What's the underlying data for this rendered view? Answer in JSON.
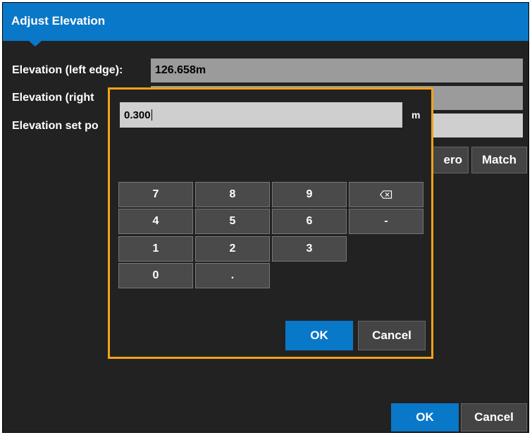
{
  "dialog": {
    "title": "Adjust Elevation",
    "rows": [
      {
        "label": "Elevation (left edge):",
        "value": "126.658m"
      },
      {
        "label": "Elevation (right",
        "value": ""
      },
      {
        "label": "Elevation set po",
        "value": ""
      }
    ],
    "buttons": {
      "zero_partial": "ero",
      "match": "Match",
      "ok": "OK",
      "cancel": "Cancel"
    }
  },
  "keypad": {
    "value": "0.300",
    "unit": "m",
    "keys": [
      "7",
      "8",
      "9",
      "4",
      "5",
      "6",
      "-",
      "1",
      "2",
      "3",
      "0",
      "."
    ],
    "icons": {
      "backspace": "backspace-icon"
    },
    "buttons": {
      "ok": "OK",
      "cancel": "Cancel"
    }
  },
  "colors": {
    "accent": "#0a78c8",
    "highlight": "#f0a416",
    "background": "#222222"
  }
}
